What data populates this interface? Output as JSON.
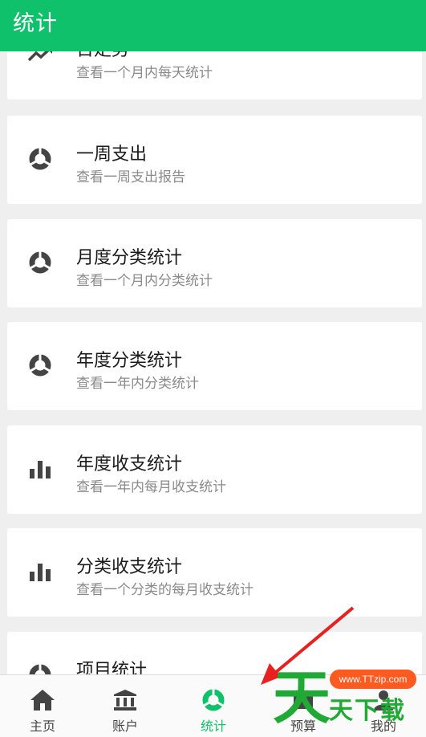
{
  "appbar": {
    "title": "统计"
  },
  "cards": [
    {
      "title": "日走势",
      "subtitle": "查看一个月内每天统计",
      "icon": "trend-line-icon"
    },
    {
      "title": "一周支出",
      "subtitle": "查看一周支出报告",
      "icon": "pie-ring-icon"
    },
    {
      "title": "月度分类统计",
      "subtitle": "查看一个月内分类统计",
      "icon": "pie-ring-icon"
    },
    {
      "title": "年度分类统计",
      "subtitle": "查看一年内分类统计",
      "icon": "pie-ring-icon"
    },
    {
      "title": "年度收支统计",
      "subtitle": "查看一年内每月收支统计",
      "icon": "bar-chart-icon"
    },
    {
      "title": "分类收支统计",
      "subtitle": "查看一个分类的每月收支统计",
      "icon": "bar-chart-icon"
    },
    {
      "title": "项目统计",
      "subtitle": "",
      "icon": "pie-ring-icon"
    }
  ],
  "tabs": [
    {
      "label": "主页",
      "icon": "home-icon",
      "active": false
    },
    {
      "label": "账户",
      "icon": "bank-icon",
      "active": false
    },
    {
      "label": "统计",
      "icon": "pie-ring-icon",
      "active": true
    },
    {
      "label": "预算",
      "icon": "budget-icon",
      "active": false
    },
    {
      "label": "我的",
      "icon": "person-icon",
      "active": false
    }
  ],
  "watermark": {
    "url": "www.TTzip.com",
    "big": "天",
    "small": "天下载"
  },
  "colors": {
    "primary": "#10c16b",
    "icon": "#444444",
    "subtitle": "#8a8a8a",
    "arrow": "#e8201f"
  }
}
